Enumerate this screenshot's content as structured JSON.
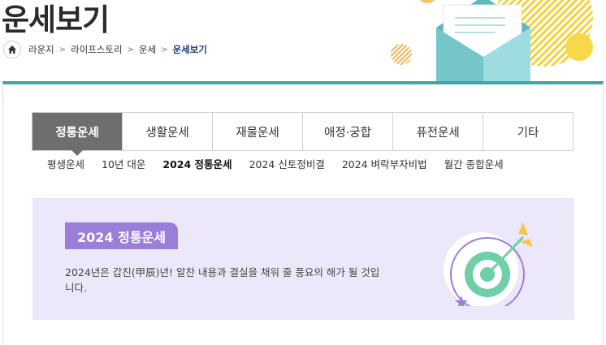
{
  "page_title": "운세보기",
  "breadcrumb": {
    "home_icon": "home-icon",
    "separator": ">",
    "items": [
      "라운지",
      "라이프스토리",
      "운세"
    ],
    "current": "운세보기"
  },
  "tabs": [
    {
      "label": "정통운세",
      "active": true
    },
    {
      "label": "생활운세",
      "active": false
    },
    {
      "label": "재물운세",
      "active": false
    },
    {
      "label": "애정·궁합",
      "active": false
    },
    {
      "label": "퓨전운세",
      "active": false
    },
    {
      "label": "기타",
      "active": false
    }
  ],
  "subtabs": [
    {
      "label": "평생운세",
      "active": false
    },
    {
      "label": "10년 대운",
      "active": false
    },
    {
      "label": "2024 정통운세",
      "active": true
    },
    {
      "label": "2024 신토정비결",
      "active": false
    },
    {
      "label": "2024 벼락부자비법",
      "active": false
    },
    {
      "label": "월간 종합운세",
      "active": false
    }
  ],
  "banner": {
    "badge": "2024 정통운세",
    "description": "2024년은 갑진(甲辰)년! 알찬 내용과 결실을 채워 줄 풍요의 해가 될 것입니다.",
    "illustration_icon": "target-arrow-icon"
  },
  "colors": {
    "accent_teal": "#3ea5a8",
    "active_tab": "#6e6e6e",
    "banner_bg": "#ece8fa",
    "badge_bg": "#9a7ed8",
    "breadcrumb_current": "#1f3d7a"
  }
}
